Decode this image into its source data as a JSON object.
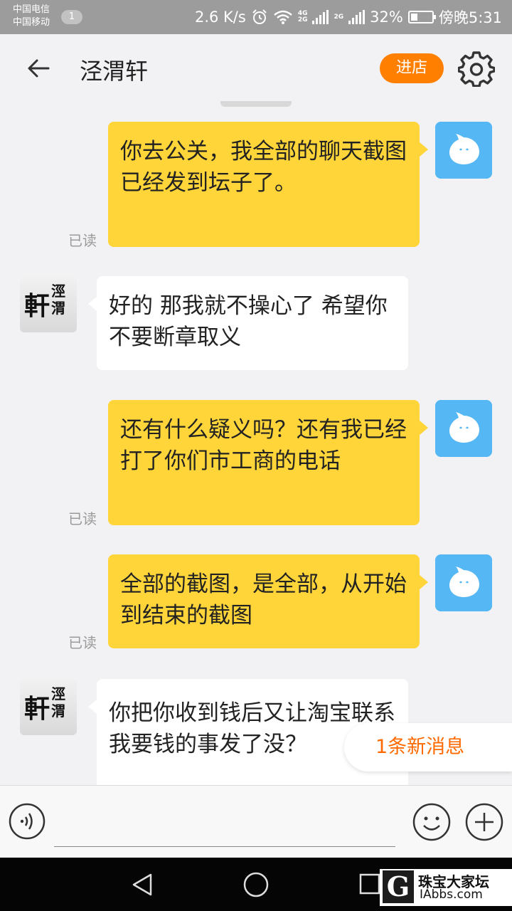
{
  "status_bar": {
    "carrier_1": "中国电信",
    "carrier_2": "中国移动",
    "sim_badge": "1",
    "speed": "2.6 K/s",
    "net_1": "4G",
    "net_1b": "2G",
    "net_2": "2G",
    "battery": "32%",
    "battery_level": 0.32,
    "time": "傍晚5:31"
  },
  "header": {
    "title": "泾渭轩",
    "enter_label": "进店"
  },
  "messages": [
    {
      "from": "me",
      "text": "你去公关，我全部的聊天截图已经发到坛子了。",
      "status": "已读"
    },
    {
      "from": "shop",
      "text": "好的 那我就不操心了 希望你不要断章取义"
    },
    {
      "from": "me",
      "text": "还有什么疑义吗？还有我已经打了你们市工商的电话",
      "status": "已读"
    },
    {
      "from": "me",
      "text": "全部的截图，是全部，从开始到结束的截图",
      "status": "已读"
    },
    {
      "from": "shop",
      "text": "你把你收到钱后又让淘宝联系我要钱的事发了没？"
    }
  ],
  "shop_avatar": {
    "big": "軒",
    "small_1": "涇",
    "small_2": "渭"
  },
  "new_message_label": "1条新消息",
  "input": {
    "value": "",
    "placeholder": ""
  },
  "watermark": {
    "logo": "G",
    "cn": "珠宝大家坛",
    "en": "IAbbs.com"
  }
}
